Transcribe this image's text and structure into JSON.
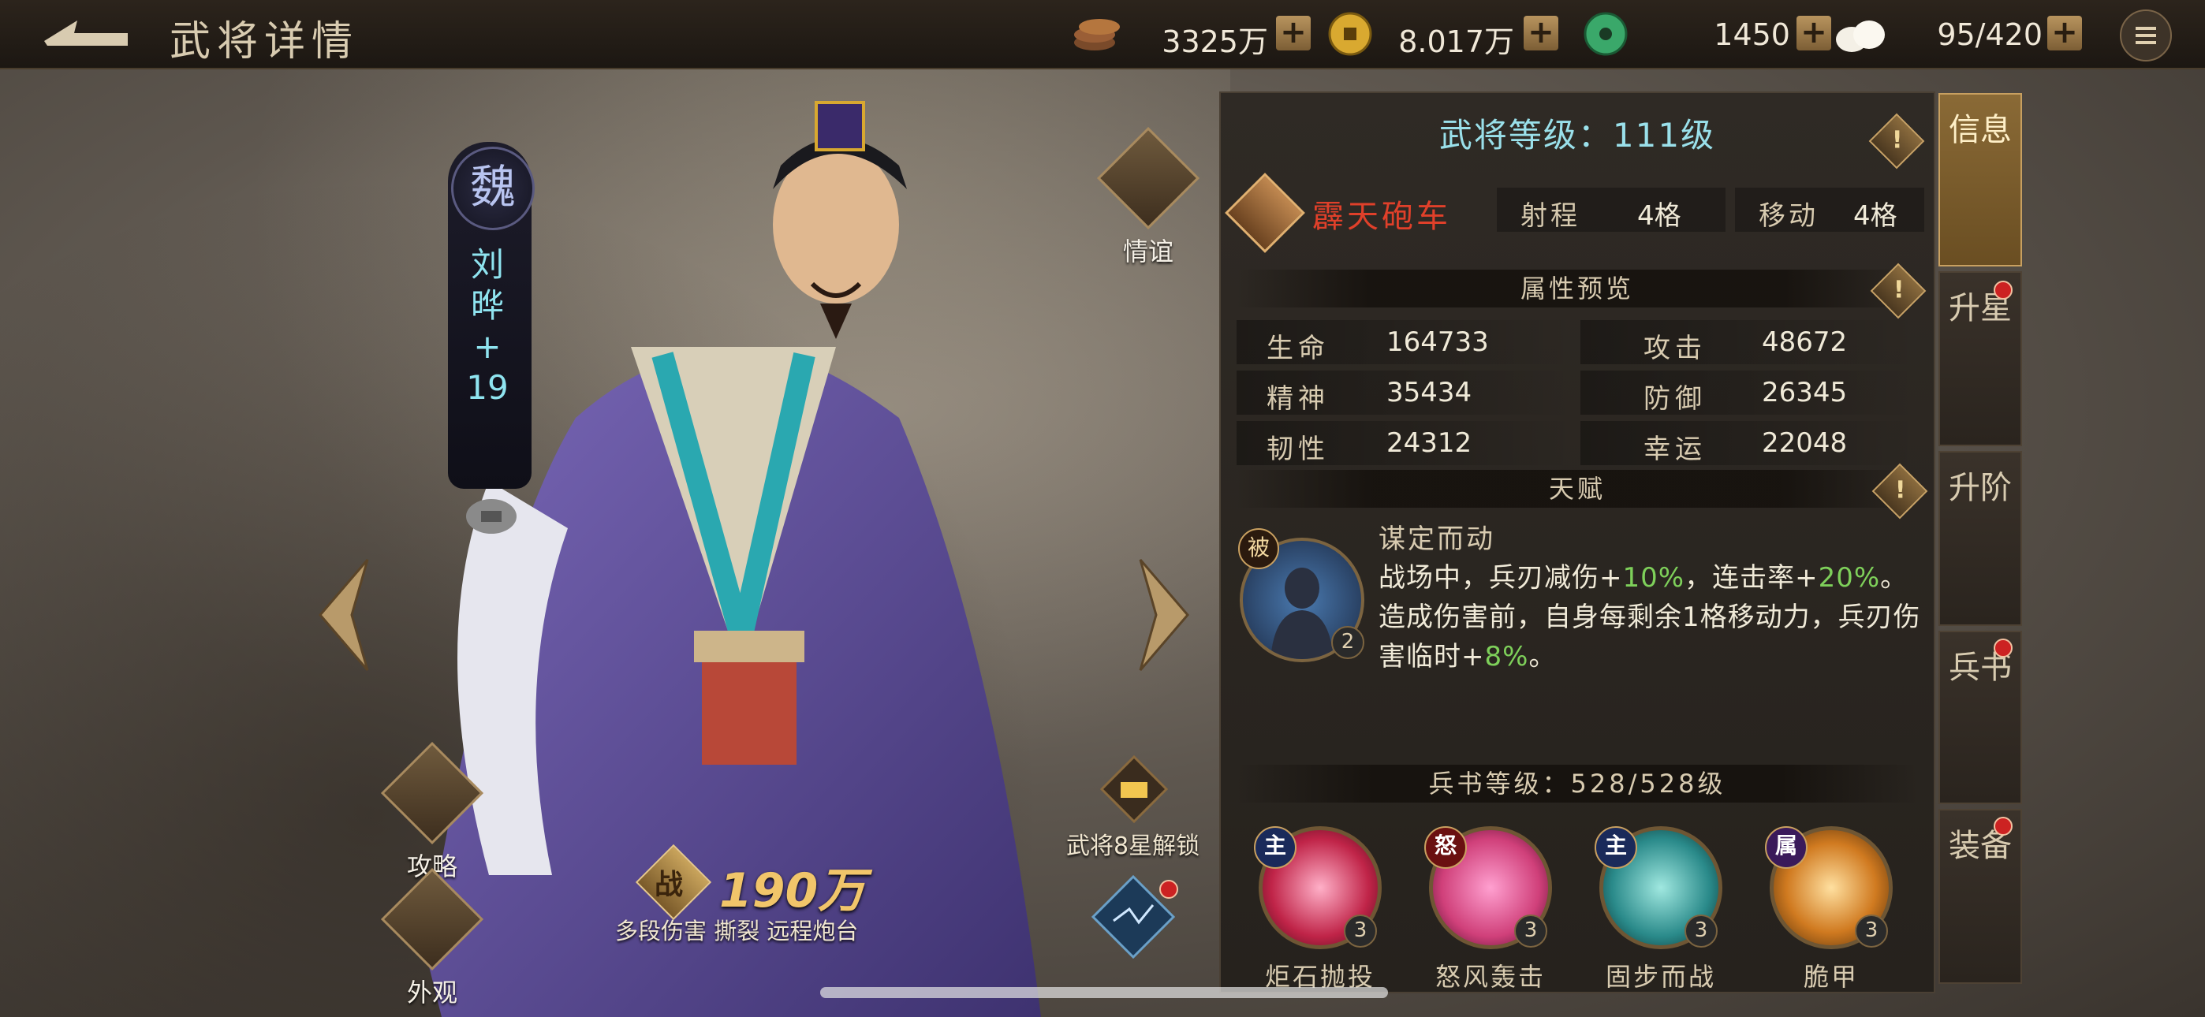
{
  "header": {
    "title": "武将详情",
    "resources": [
      {
        "icon": "copper-coins-icon",
        "value": "3325万"
      },
      {
        "icon": "gold-coin-icon",
        "value": "8.017万"
      },
      {
        "icon": "jade-icon",
        "value": "1450"
      },
      {
        "icon": "mantou-food-icon",
        "value": "95/420"
      }
    ],
    "plus": "+"
  },
  "hero": {
    "kingdom": "魏",
    "name": "刘晔",
    "plus_level": "+19",
    "friendship_label": "情谊",
    "strategy_label": "攻略",
    "appearance_label": "外观",
    "power_badge": "战",
    "power": "190万",
    "tags": "多段伤害 撕裂 远程炮台",
    "star_unlock": "武将8星解锁"
  },
  "panel": {
    "level": "武将等级：111级",
    "unit": {
      "name": "霹天砲车",
      "range_label": "射程",
      "range_value": "4格",
      "move_label": "移动",
      "move_value": "4格"
    },
    "attr_header": "属性预览",
    "stats": [
      {
        "label": "生命",
        "value": "164733"
      },
      {
        "label": "攻击",
        "value": "48672"
      },
      {
        "label": "精神",
        "value": "35434"
      },
      {
        "label": "防御",
        "value": "26345"
      },
      {
        "label": "韧性",
        "value": "24312"
      },
      {
        "label": "幸运",
        "value": "22048"
      }
    ],
    "talent_header": "天赋",
    "talent": {
      "badge": "被",
      "level": "2",
      "name": "谋定而动",
      "desc_parts": [
        "战场中，兵刃减伤+",
        "10%",
        "，连击率+",
        "20%",
        "。造成伤害前，自身每剩余1格移动力，兵刃伤害临时+",
        "8%",
        "。"
      ]
    },
    "book_header": "兵书等级：528/528级",
    "skills": [
      {
        "tag": "主",
        "name": "炬石抛投",
        "level": "3",
        "color": "#c02448"
      },
      {
        "tag": "怒",
        "name": "怒风轰击",
        "level": "3",
        "color": "#d0407a"
      },
      {
        "tag": "主",
        "name": "固步而战",
        "level": "3",
        "color": "#2a8a8a"
      },
      {
        "tag": "属",
        "name": "脆甲",
        "level": "3",
        "color": "#d07a20"
      }
    ],
    "info_glyph": "!"
  },
  "tabs": [
    {
      "label": "信息",
      "active": true
    },
    {
      "label": "升星",
      "active": false
    },
    {
      "label": "升阶",
      "active": false
    },
    {
      "label": "兵书",
      "active": false
    },
    {
      "label": "装备",
      "active": false
    }
  ],
  "colors": {
    "accent_gold": "#c8a060",
    "cyan_text": "#9ae0ea",
    "unit_red": "#e0402a",
    "bonus_green": "#7ed05a"
  }
}
